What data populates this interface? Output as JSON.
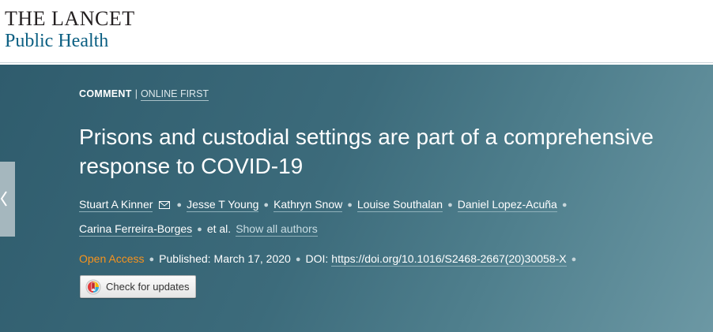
{
  "logo": {
    "line1": "THE LANCET",
    "line2": "Public Health"
  },
  "article": {
    "type": "COMMENT",
    "separator": "|",
    "status": "ONLINE FIRST",
    "title": "Prisons and custodial settings are part of a comprehensive response to COVID-19",
    "authors": [
      "Stuart A Kinner",
      "Jesse T Young",
      "Kathryn Snow",
      "Louise Southalan",
      "Daniel Lopez-Acuña",
      "Carina Ferreira-Borges"
    ],
    "et_al": "et al.",
    "show_all_authors": "Show all authors",
    "access": "Open Access",
    "published_label": "Published:",
    "published_date": "March 17, 2020",
    "doi_label": "DOI:",
    "doi": "https://doi.org/10.1016/S2468-2667(20)30058-X",
    "check_updates_label": "Check for updates"
  },
  "icons": {
    "email": "envelope-icon",
    "side_tab": "chevron-left-icon",
    "updates": "check-for-updates-icon"
  },
  "colors": {
    "hero": "#3c6b7b",
    "open_access": "#f7931d",
    "logo_accent": "#0b5f82"
  }
}
